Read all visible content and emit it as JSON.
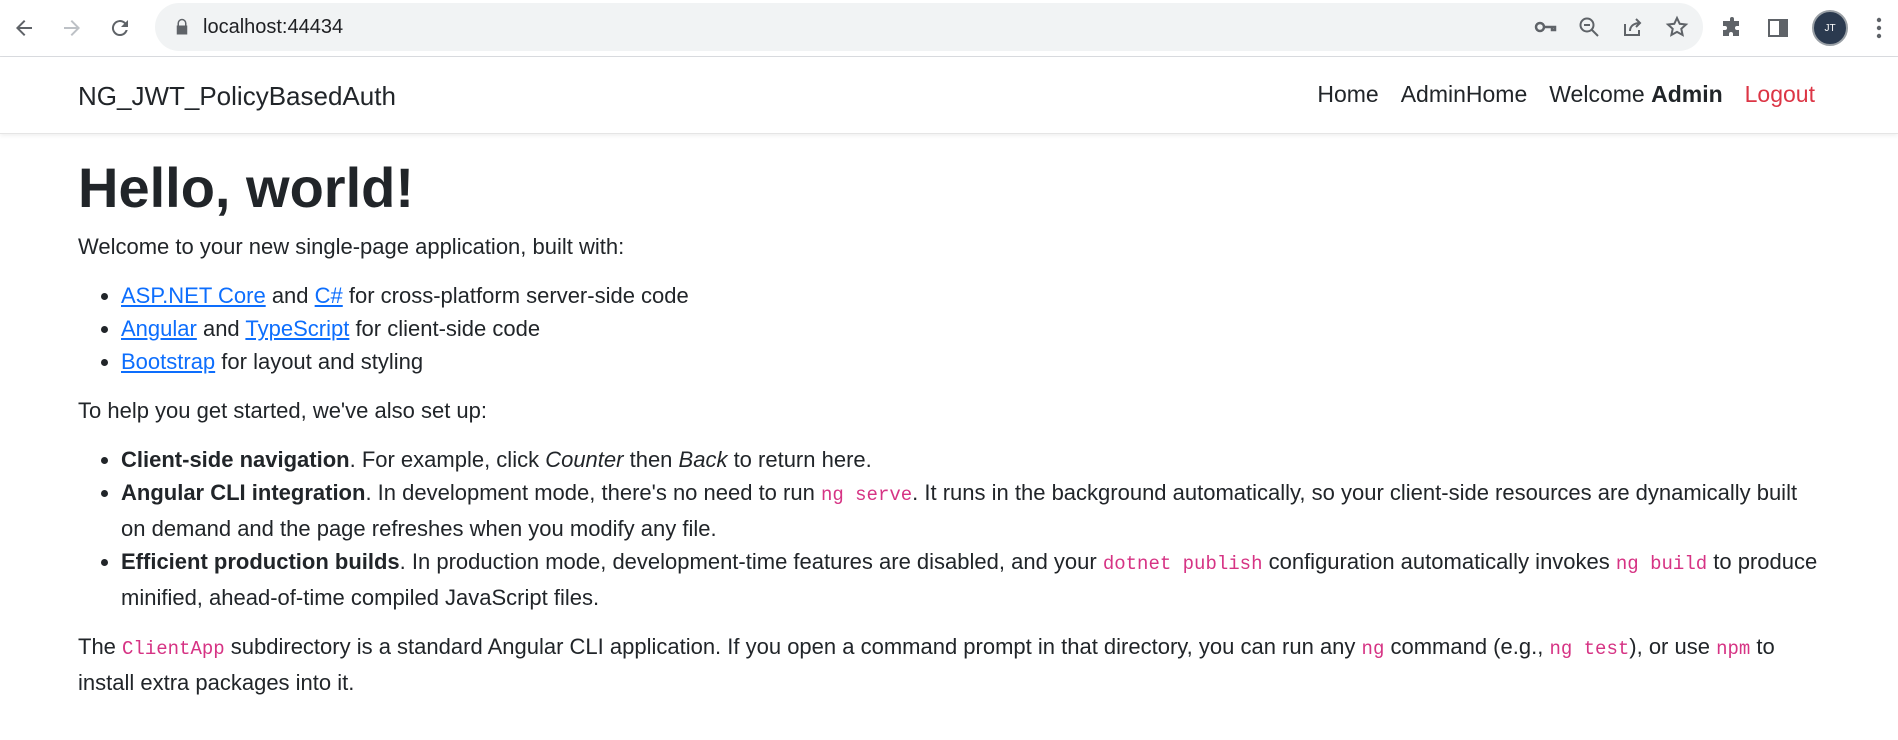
{
  "browser": {
    "url": "localhost:44434",
    "avatar_initials": "JT"
  },
  "navbar": {
    "brand": "NG_JWT_PolicyBasedAuth",
    "home": "Home",
    "admin_home": "AdminHome",
    "welcome": "Welcome",
    "user": "Admin",
    "logout": "Logout"
  },
  "main": {
    "heading": "Hello, world!",
    "intro": "Welcome to your new single-page application, built with:",
    "tech": [
      {
        "link1": "ASP.NET Core",
        "mid": " and ",
        "link2": "C#",
        "tail": " for cross-platform server-side code"
      },
      {
        "link1": "Angular",
        "mid": " and ",
        "link2": "TypeScript",
        "tail": " for client-side code"
      },
      {
        "link1": "Bootstrap",
        "tail": " for layout and styling"
      }
    ],
    "setup_intro": "To help you get started, we've also set up:",
    "features": [
      {
        "title": "Client-side navigation",
        "t1": ". For example, click ",
        "i1": "Counter",
        "t2": " then ",
        "i2": "Back",
        "t3": " to return here."
      },
      {
        "title": "Angular CLI integration",
        "t1": ". In development mode, there's no need to run ",
        "code1": "ng serve",
        "t2": ". It runs in the background automatically, so your client-side resources are dynamically built on demand and the page refreshes when you modify any file."
      },
      {
        "title": "Efficient production builds",
        "t1": ". In production mode, development-time features are disabled, and your ",
        "code1": "dotnet publish",
        "t2": " configuration automatically invokes ",
        "code2": "ng build",
        "t3": " to produce minified, ahead-of-time compiled JavaScript files."
      }
    ],
    "footer": {
      "t1": "The ",
      "code1": "ClientApp",
      "t2": " subdirectory is a standard Angular CLI application. If you open a command prompt in that directory, you can run any ",
      "code2": "ng",
      "t3": " command (e.g., ",
      "code3": "ng test",
      "t4": "), or use ",
      "code4": "npm",
      "t5": " to install extra packages into it."
    }
  }
}
